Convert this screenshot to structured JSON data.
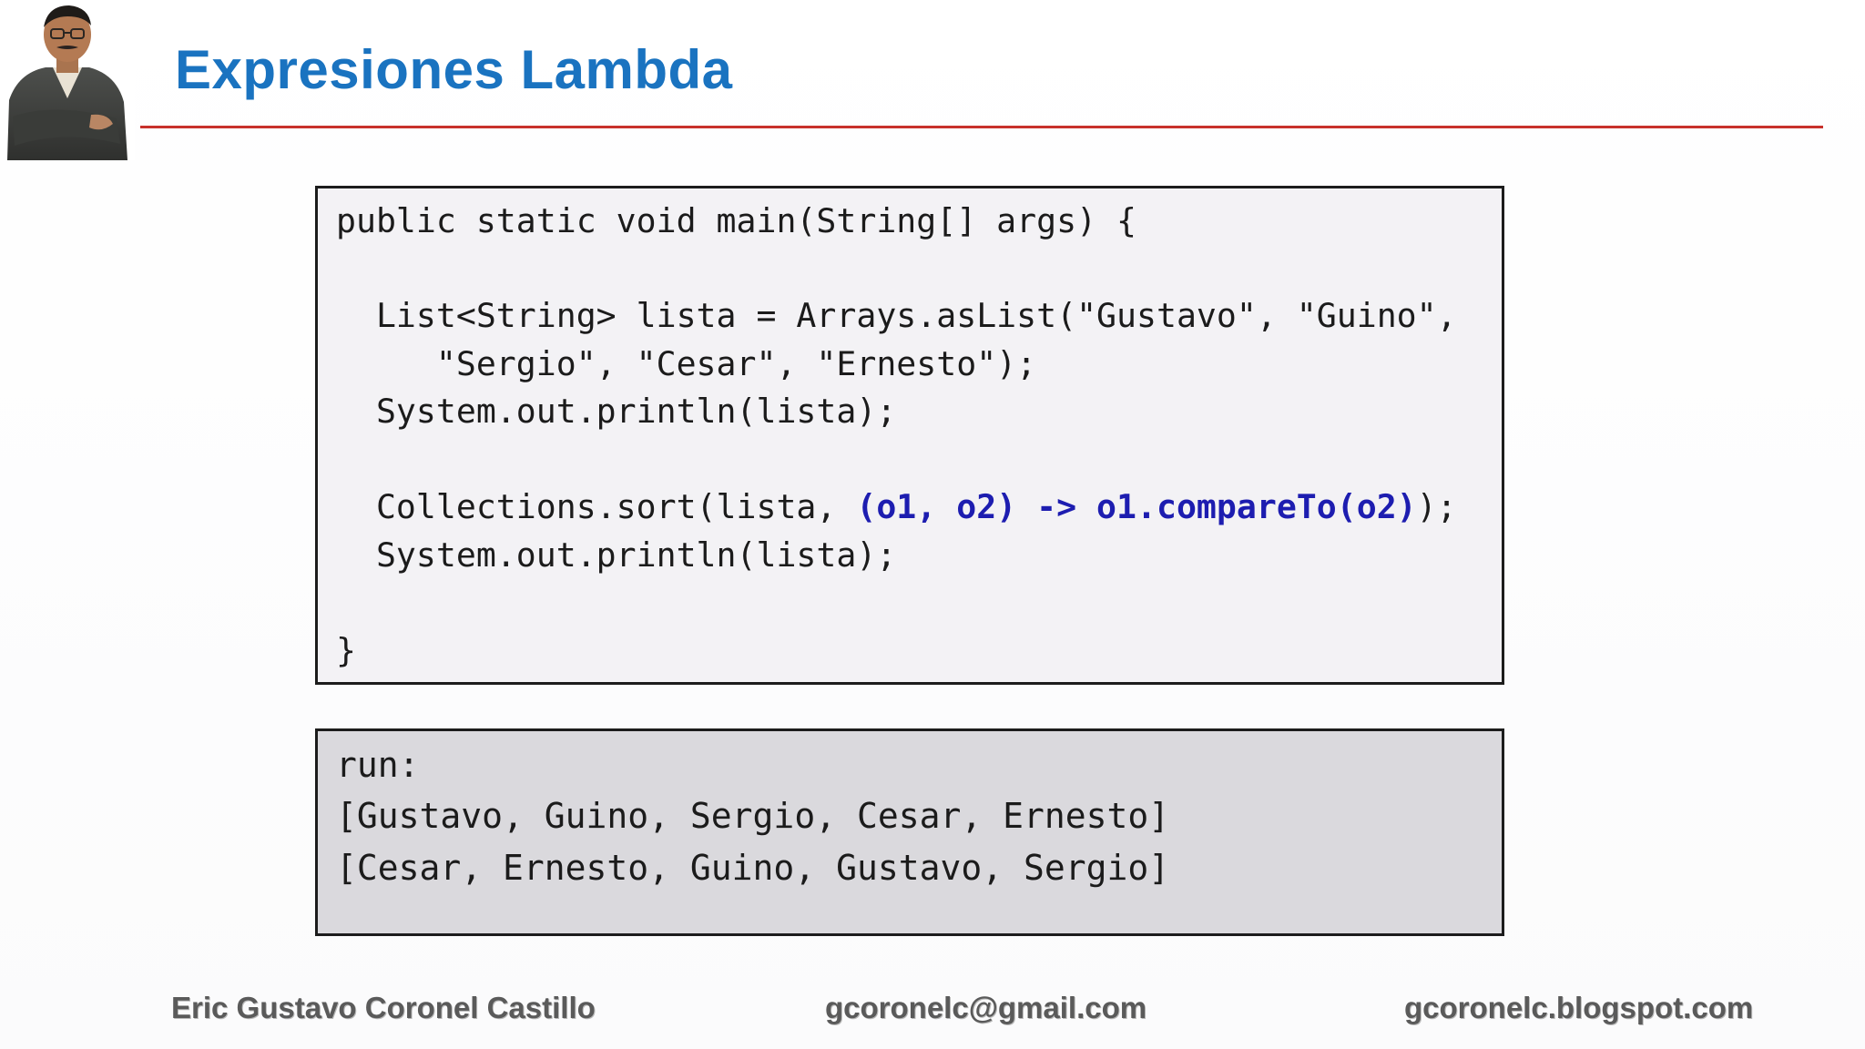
{
  "slide": {
    "title": "Expresiones Lambda"
  },
  "code": {
    "lines": [
      "public static void main(String[] args) {",
      "  List<String> lista = Arrays.asList(\"Gustavo\", \"Guino\",",
      "     \"Sergio\", \"Cesar\", \"Ernesto\");",
      "  System.out.println(lista);",
      "  Collections.sort(lista, ",
      "(o1, o2) -> o1.compareTo(o2)",
      ");",
      "  System.out.println(lista);",
      "}"
    ]
  },
  "output": {
    "lines": [
      "run:",
      "[Gustavo, Guino, Sergio, Cesar, Ernesto]",
      "[Cesar, Ernesto, Guino, Gustavo, Sergio]"
    ]
  },
  "footer": {
    "author": "Eric Gustavo Coronel Castillo",
    "email": "gcoronelc@gmail.com",
    "blog": "gcoronelc.blogspot.com"
  },
  "colors": {
    "title": "#1a73c0",
    "rule": "#c8312b",
    "lambda_highlight": "#1d1db0"
  },
  "icons": {
    "presenter": "presenter-photo"
  }
}
